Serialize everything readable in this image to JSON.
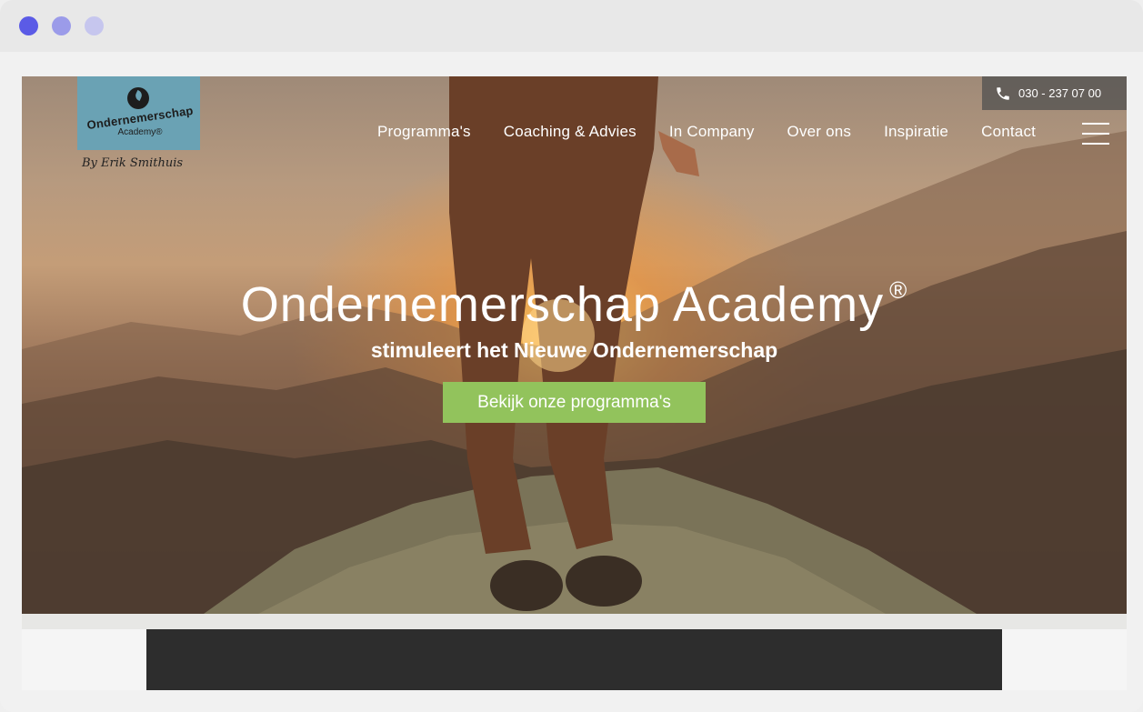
{
  "window": {
    "controls": [
      "close",
      "minimize",
      "maximize"
    ]
  },
  "header": {
    "phone": {
      "icon": "phone-icon",
      "number": "030 - 237 07 00"
    },
    "logo": {
      "line1": "Ondernemerschap",
      "line2": "Academy®",
      "byline": "By Erik Smithuis"
    },
    "nav": [
      {
        "label": "Programma's"
      },
      {
        "label": "Coaching & Advies"
      },
      {
        "label": "In Company"
      },
      {
        "label": "Over ons"
      },
      {
        "label": "Inspiratie"
      },
      {
        "label": "Contact"
      }
    ],
    "menu_icon": "hamburger-menu-icon"
  },
  "hero": {
    "title": "Ondernemerschap Academy",
    "title_mark": "®",
    "subtitle": "stimuleert het Nieuwe Ondernemerschap",
    "cta": "Bekijk onze programma's"
  },
  "colors": {
    "cta": "#92c35c",
    "logo_bg": "#6aa2b4",
    "video_bg": "#2d2d2d"
  }
}
